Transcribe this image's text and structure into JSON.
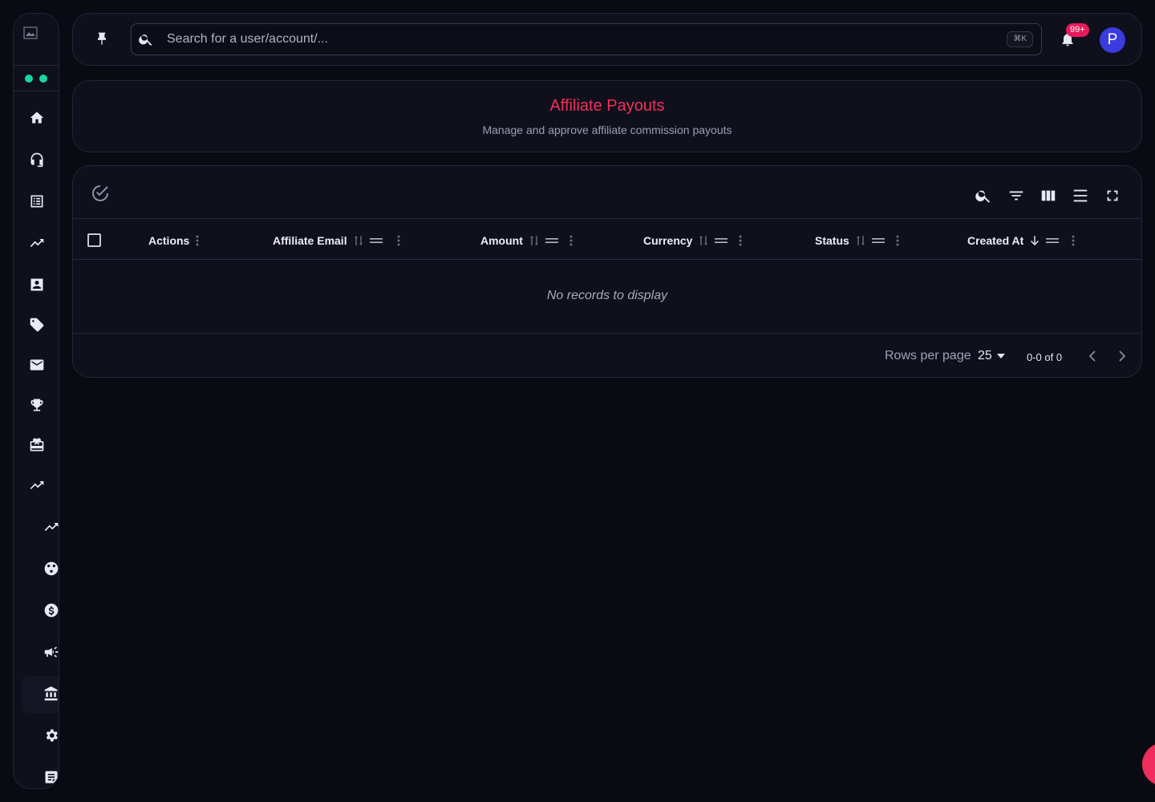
{
  "search": {
    "placeholder": "Search for a user/account/...",
    "shortcut": "⌘K"
  },
  "notifications": {
    "count": "99+"
  },
  "user": {
    "initial": "P"
  },
  "page": {
    "title": "Affiliate Payouts",
    "subtitle": "Manage and approve affiliate commission payouts"
  },
  "table": {
    "columns": [
      "Actions",
      "Affiliate Email",
      "Amount",
      "Currency",
      "Status",
      "Created At"
    ],
    "empty_text": "No records to display"
  },
  "pagination": {
    "rows_label": "Rows per page",
    "rows_value": "25",
    "range": "0-0 of 0"
  },
  "colors": {
    "accent": "#f2305e",
    "status_dot": "#19d6a4",
    "badge": "#e8195c",
    "avatar": "#3b3bdf"
  }
}
